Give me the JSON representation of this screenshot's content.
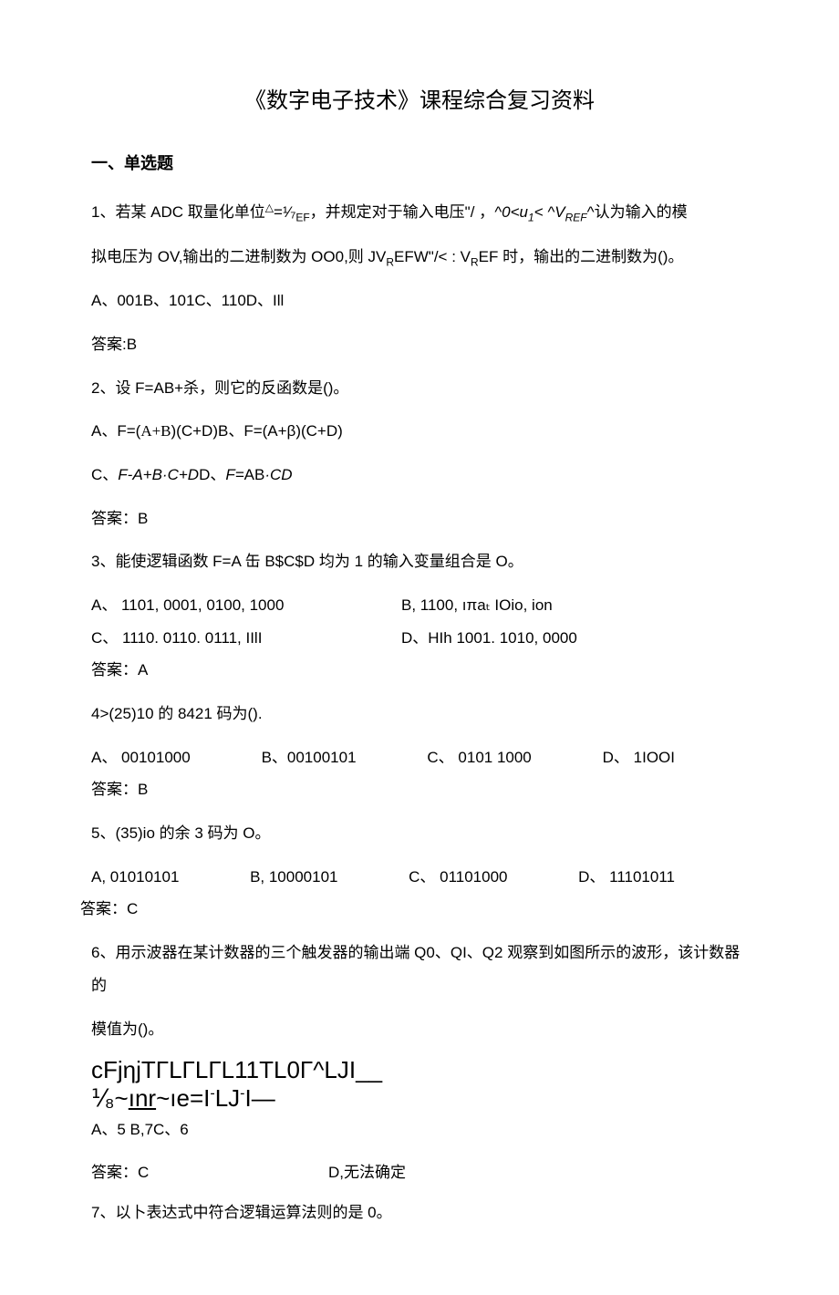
{
  "title": "《数字电子技术》课程综合复习资料",
  "section1": "一、单选题",
  "q1": {
    "line1a": "1、若某 ADC 取量化单位",
    "line1b": "=¹⁄₇",
    "line1c": "，并规定对于输入电压\"/ ，",
    "line1d": "^0<u",
    "line1e": "1",
    "line1f": "< ^V",
    "line1g": "REF",
    "line1h": "^认为输入的模",
    "line2a": "拟电压为 OV,输出的二进制数为 OO0,则 JV",
    "line2b": "R",
    "line2c": "EFW\"/< : V",
    "line2d": "R",
    "line2e": "EF 时，输出的二进制数为()。",
    "opts": "A、001B、101C、110D、Ill",
    "ans": "答案:B"
  },
  "q2": {
    "stem": "2、设 F=AB+杀，则它的反函数是()。",
    "optsAB_a": "A、F=(",
    "optsAB_b": "A+B",
    "optsAB_c": ")(C+D)B、F=(A+β)(C+D)",
    "optsCD_a": "C、",
    "optsCD_b": "F-A+B·C+D",
    "optsCD_c": "D、",
    "optsCD_d": "F=",
    "optsCD_e": "AB",
    "optsCD_f": "·",
    "optsCD_g": "CD",
    "ans": "答案：B"
  },
  "q3": {
    "stem": "3、能使逻辑函数 F=A 缶 B$C$D 均为 1 的输入变量组合是 O。",
    "optA": "A、 1101, 0001, 0100, 1000",
    "optB": "B, 1100,   ıπaₜ IOio, ion",
    "optC": "C、 1110. 0110. 0111, IIlI",
    "optD": "D、HIh   1001. 1010, 0000",
    "ans": "答案：A"
  },
  "q4": {
    "stem": "4>(25)10 的 8421 码为().",
    "optA": "A、 00101000",
    "optB": "B、00100101",
    "optC": "C、 0101 1000",
    "optD": "D、 1IOOI",
    "ans": "答案：B"
  },
  "q5": {
    "stem": "5、(35)io 的余 3 码为 O。",
    "optA": "A, 01010101",
    "optB": "B, 10000101",
    "optC": "C、 01101000",
    "optD": "D、 11101011",
    "ans": "答案：C"
  },
  "q6": {
    "stem1": "6、用示波器在某计数器的三个触发器的输出端 Q0、QI、Q2 观察到如图所示的波形，该计数器的",
    "stem2": "模值为()。",
    "wave1": "cFjηjTΓLΓLΓL11TL0Γ^LJI__",
    "wave2a": "⅟₈~",
    "wave2b": "ınr",
    "wave2c": "~ıe=I",
    "wave2d": "-",
    "wave2e": "LJ",
    "wave2f": "-",
    "wave2g": "I—",
    "optsAB": "A、5     B,7C、6",
    "optD": "D,无法确定",
    "ans": "答案：C"
  },
  "q7": {
    "stem": "7、以卜表达式中符合逻辑运算法则的是 0。"
  }
}
